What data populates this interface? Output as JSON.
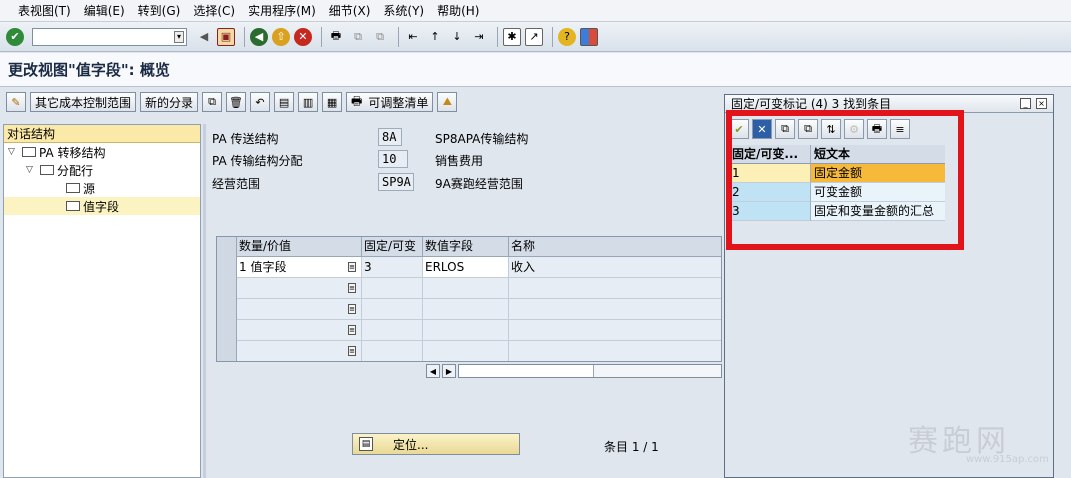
{
  "menu": [
    "表视图(T)",
    "编辑(E)",
    "转到(G)",
    "选择(C)",
    "实用程序(M)",
    "细节(X)",
    "系统(Y)",
    "帮助(H)"
  ],
  "title": "更改视图\"值字段\": 概览",
  "app_toolbar": {
    "btn_other_cost": "其它成本控制范围",
    "btn_new_entries": "新的分录",
    "btn_adjustable_list": "可调整清单"
  },
  "tree": {
    "header": "对话结构",
    "nodes": [
      {
        "label": "PA 转移结构",
        "level": 0,
        "twisty": "▽"
      },
      {
        "label": "分配行",
        "level": 1,
        "twisty": "▽"
      },
      {
        "label": "源",
        "level": 2,
        "twisty": ""
      },
      {
        "label": "值字段",
        "level": 2,
        "twisty": ""
      }
    ]
  },
  "fields": [
    {
      "label": "PA 传送结构",
      "value": "8A",
      "desc": "SP8APA传输结构"
    },
    {
      "label": "PA 传输结构分配",
      "value": "10",
      "desc": "销售费用"
    },
    {
      "label": "经营范围",
      "value": "SP9A",
      "desc": "9A赛跑经营范围"
    }
  ],
  "table": {
    "headers": [
      "数量/价值",
      "固定/可变",
      "数值字段",
      "名称"
    ],
    "rows": [
      {
        "c1": "1 值字段",
        "c2": "3",
        "c3": "ERLOS",
        "c4": "收入"
      },
      {
        "c1": "",
        "c2": "",
        "c3": "",
        "c4": ""
      },
      {
        "c1": "",
        "c2": "",
        "c3": "",
        "c4": ""
      },
      {
        "c1": "",
        "c2": "",
        "c3": "",
        "c4": ""
      },
      {
        "c1": "",
        "c2": "",
        "c3": "",
        "c4": ""
      }
    ]
  },
  "position_btn": "定位...",
  "entry_text": "条目 1 / 1",
  "popup": {
    "title": "固定/可变标记 (4)   3 找到条目",
    "headers": [
      "固定/可变...",
      "短文本"
    ],
    "rows": [
      {
        "key": "1",
        "text": "固定金额"
      },
      {
        "key": "2",
        "text": "可变金额"
      },
      {
        "key": "3",
        "text": "固定和变量金额的汇总"
      }
    ]
  },
  "watermark": {
    "main": "赛跑网",
    "sub": "www.915ap.com"
  }
}
